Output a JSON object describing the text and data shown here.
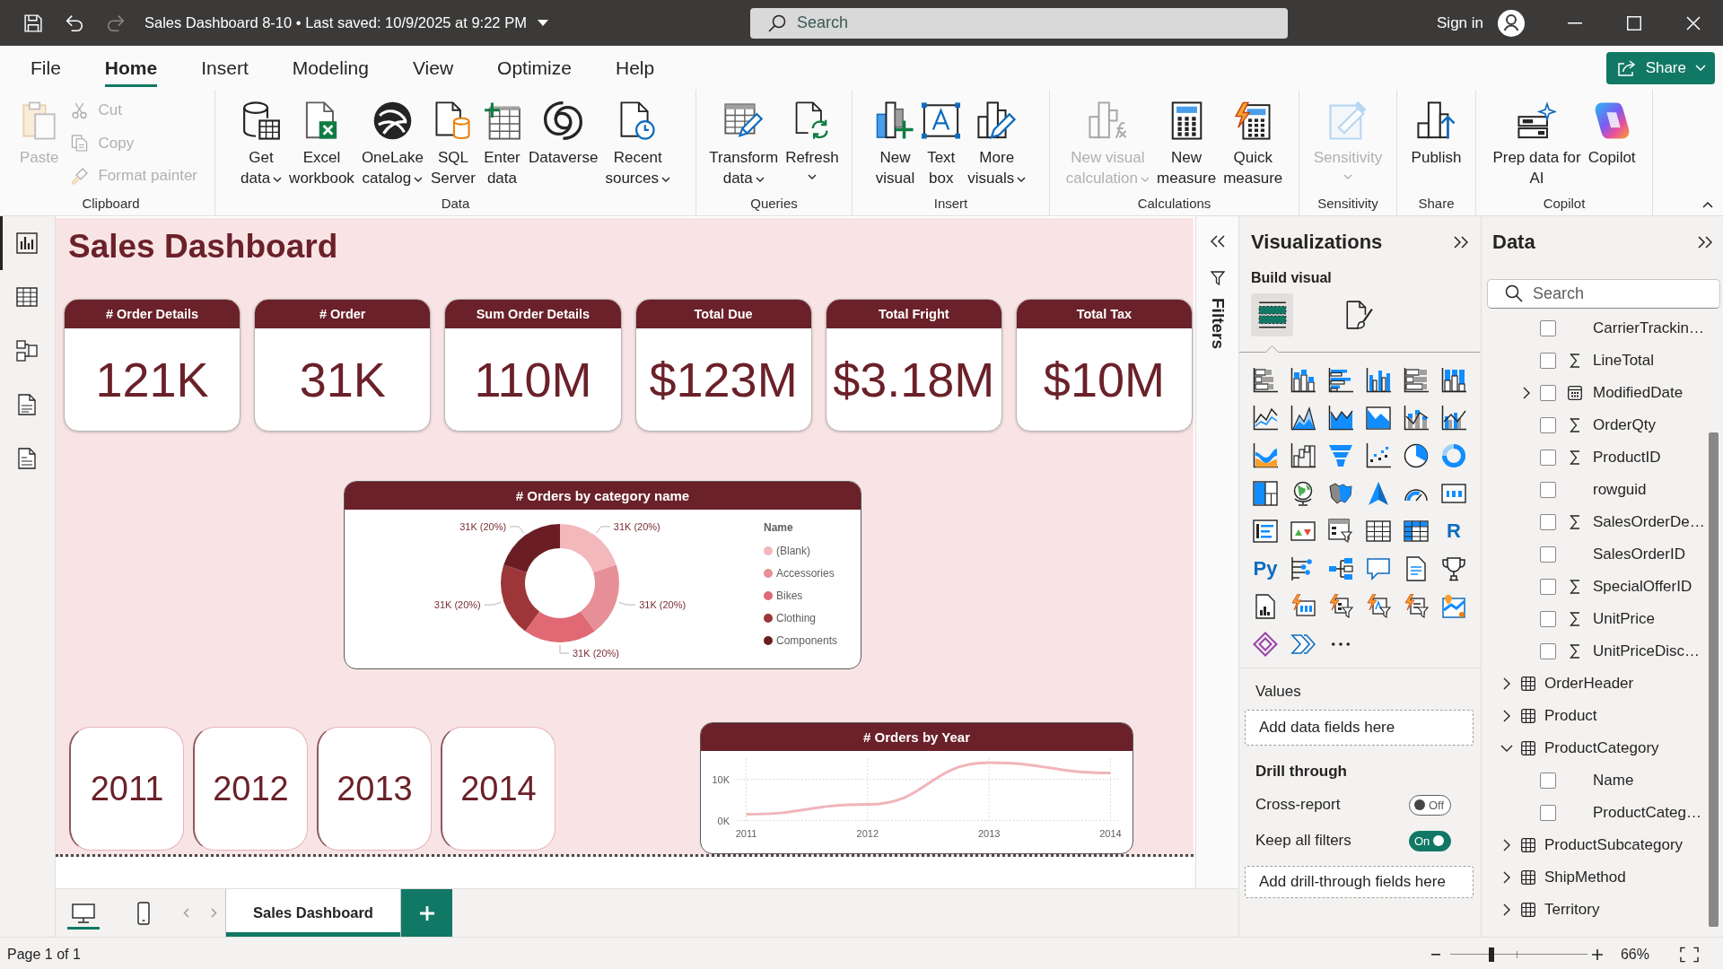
{
  "title_bar": {
    "quick_access": [
      {
        "disabled": false
      },
      {
        "disabled": false
      },
      {
        "disabled": true
      }
    ],
    "title": "Sales Dashboard 8-10 • Last saved: 10/9/2025 at 9:22 PM",
    "search": {
      "placeholder": "Search"
    },
    "sign_in": "Sign in"
  },
  "menu_tabs": [
    {
      "label": "File",
      "selected": false
    },
    {
      "label": "Home",
      "selected": true
    },
    {
      "label": "Insert",
      "selected": false
    },
    {
      "label": "Modeling",
      "selected": false
    },
    {
      "label": "View",
      "selected": false
    },
    {
      "label": "Optimize",
      "selected": false
    },
    {
      "label": "Help",
      "selected": false
    }
  ],
  "share_button": {
    "label": "Share"
  },
  "ribbon": {
    "groups": [
      {
        "label": "Clipboard",
        "items": [
          {
            "kind": "large",
            "label": "Paste",
            "dropdown": false,
            "disabled": true
          },
          {
            "kind": "small",
            "label": "Cut",
            "dropdown": false,
            "disabled": true
          },
          {
            "kind": "small",
            "label": "Copy",
            "dropdown": false,
            "disabled": true
          },
          {
            "kind": "small",
            "label": "Format painter",
            "dropdown": false,
            "disabled": true
          }
        ]
      },
      {
        "label": "Data",
        "items": [
          {
            "kind": "large",
            "label": "Get\ndata",
            "dropdown": true,
            "disabled": false
          },
          {
            "kind": "large",
            "label": "Excel\nworkbook",
            "dropdown": false,
            "disabled": false
          },
          {
            "kind": "large",
            "label": "OneLake\ncatalog",
            "dropdown": true,
            "disabled": false
          },
          {
            "kind": "large",
            "label": "SQL\nServer",
            "dropdown": false,
            "disabled": false
          },
          {
            "kind": "large",
            "label": "Enter\ndata",
            "dropdown": false,
            "disabled": false
          },
          {
            "kind": "large",
            "label": "Dataverse",
            "dropdown": false,
            "disabled": false
          },
          {
            "kind": "large",
            "label": "Recent\nsources",
            "dropdown": true,
            "disabled": false
          }
        ]
      },
      {
        "label": "Queries",
        "items": [
          {
            "kind": "large",
            "label": "Transform\ndata",
            "dropdown": true,
            "disabled": false
          },
          {
            "kind": "large",
            "label": "Refresh",
            "dropdown": true,
            "disabled": false
          }
        ]
      },
      {
        "label": "Insert",
        "items": [
          {
            "kind": "large",
            "label": "New\nvisual",
            "dropdown": false,
            "disabled": false
          },
          {
            "kind": "large",
            "label": "Text\nbox",
            "dropdown": false,
            "disabled": false
          },
          {
            "kind": "large",
            "label": "More\nvisuals",
            "dropdown": true,
            "disabled": false
          }
        ]
      },
      {
        "label": "Calculations",
        "items": [
          {
            "kind": "large",
            "label": "New visual\ncalculation",
            "dropdown": true,
            "disabled": true
          },
          {
            "kind": "large",
            "label": "New\nmeasure",
            "dropdown": false,
            "disabled": false
          },
          {
            "kind": "large",
            "label": "Quick\nmeasure",
            "dropdown": false,
            "disabled": false
          }
        ]
      },
      {
        "label": "Sensitivity",
        "items": [
          {
            "kind": "large",
            "label": "Sensitivity",
            "dropdown": true,
            "disabled": true
          }
        ]
      },
      {
        "label": "Share",
        "items": [
          {
            "kind": "large",
            "label": "Publish",
            "dropdown": false,
            "disabled": false
          }
        ]
      },
      {
        "label": "Copilot",
        "items": [
          {
            "kind": "large",
            "label": "Prep data for\nAI",
            "dropdown": false,
            "disabled": false
          },
          {
            "kind": "large",
            "label": "Copilot",
            "dropdown": false,
            "disabled": false
          }
        ]
      }
    ]
  },
  "left_rail": [
    {
      "selected": true
    },
    {
      "selected": false
    },
    {
      "selected": false
    },
    {
      "selected": false
    },
    {
      "selected": false
    }
  ],
  "canvas": {
    "title": "Sales Dashboard",
    "cards": [
      {
        "label": "# Order Details",
        "value": "121K"
      },
      {
        "label": "# Order",
        "value": "31K"
      },
      {
        "label": "Sum Order Details",
        "value": "110M"
      },
      {
        "label": "Total Due",
        "value": "$123M"
      },
      {
        "label": "Total Fright",
        "value": "$3.18M"
      },
      {
        "label": "Total Tax",
        "value": "$10M"
      }
    ],
    "category_chart": {
      "chart_data": {
        "type": "donut",
        "title": "# Orders by category name",
        "categories": [
          "(Blank)",
          "Accessories",
          "Bikes",
          "Clothing",
          "Components"
        ],
        "values": [
          31000,
          31000,
          31000,
          31000,
          31000
        ],
        "colors": [
          "#f2b8bc",
          "#e68f97",
          "#e06974",
          "#9d3639",
          "#6a1e24"
        ],
        "value_labels": [
          "31K (20%)",
          "31K (20%)",
          "31K (20%)",
          "31K (20%)",
          "31K (20%)"
        ],
        "legend_title": "Name",
        "legend": "right"
      }
    },
    "year_tiles": [
      {
        "label": "2011"
      },
      {
        "label": "2012"
      },
      {
        "label": "2013"
      },
      {
        "label": "2014"
      }
    ],
    "year_chart": {
      "chart_data": {
        "type": "line",
        "title": "# Orders by Year",
        "categories": [
          "2011",
          "2012",
          "2013",
          "2014"
        ],
        "values": [
          1500,
          3900,
          14000,
          11500
        ],
        "color": "#f0b5b9",
        "yticks": [
          {
            "value": 0,
            "label": "0K"
          },
          {
            "value": 10000,
            "label": "10K"
          }
        ],
        "ylim": [
          0,
          15000
        ],
        "grid": true
      }
    }
  },
  "page_bar": {
    "views": [
      {
        "selected": true
      },
      {
        "selected": false
      }
    ],
    "pages": [
      {
        "label": "Sales Dashboard",
        "selected": true
      }
    ]
  },
  "filters_pane": {
    "label": "Filters"
  },
  "visualizations": {
    "title": "Visualizations",
    "subtitle": "Build visual",
    "build_tabs": [
      {
        "selected": true
      },
      {
        "selected": false
      }
    ],
    "glyph_icons": [
      "R",
      "Py"
    ],
    "values": {
      "label": "Values",
      "hint": "Add data fields here"
    },
    "drill_through": {
      "title": "Drill through",
      "toggles": [
        {
          "label": "Cross-report",
          "on": false,
          "state_text": "Off"
        },
        {
          "label": "Keep all filters",
          "on": true,
          "state_text": "On"
        }
      ],
      "hint": "Add drill-through fields here"
    }
  },
  "data_pane": {
    "title": "Data",
    "search": {
      "placeholder": "Search"
    },
    "tree": [
      {
        "kind": "text",
        "label": "CarrierTrackin…",
        "checked": false
      },
      {
        "kind": "numeric",
        "label": "LineTotal",
        "checked": false
      },
      {
        "kind": "date",
        "label": "ModifiedDate",
        "checked": false,
        "expanded": false
      },
      {
        "kind": "numeric",
        "label": "OrderQty",
        "checked": false
      },
      {
        "kind": "numeric",
        "label": "ProductID",
        "checked": false
      },
      {
        "kind": "text",
        "label": "rowguid",
        "checked": false
      },
      {
        "kind": "numeric",
        "label": "SalesOrderDe…",
        "checked": false
      },
      {
        "kind": "text",
        "label": "SalesOrderID",
        "checked": false
      },
      {
        "kind": "numeric",
        "label": "SpecialOfferID",
        "checked": false
      },
      {
        "kind": "numeric",
        "label": "UnitPrice",
        "checked": false
      },
      {
        "kind": "numeric",
        "label": "UnitPriceDisc…",
        "checked": false
      },
      {
        "kind": "table",
        "label": "OrderHeader",
        "expanded": false
      },
      {
        "kind": "table",
        "label": "Product",
        "expanded": false
      },
      {
        "kind": "table",
        "label": "ProductCategory",
        "expanded": true,
        "children": [
          {
            "kind": "text",
            "label": "Name",
            "checked": false
          },
          {
            "kind": "text",
            "label": "ProductCateg…",
            "checked": false
          }
        ]
      },
      {
        "kind": "table",
        "label": "ProductSubcategory",
        "expanded": false
      },
      {
        "kind": "table",
        "label": "ShipMethod",
        "expanded": false
      },
      {
        "kind": "table",
        "label": "Territory",
        "expanded": false
      }
    ]
  },
  "status_bar": {
    "page": "Page 1 of 1",
    "zoom": {
      "level": 0.3,
      "reading": "66%"
    }
  }
}
